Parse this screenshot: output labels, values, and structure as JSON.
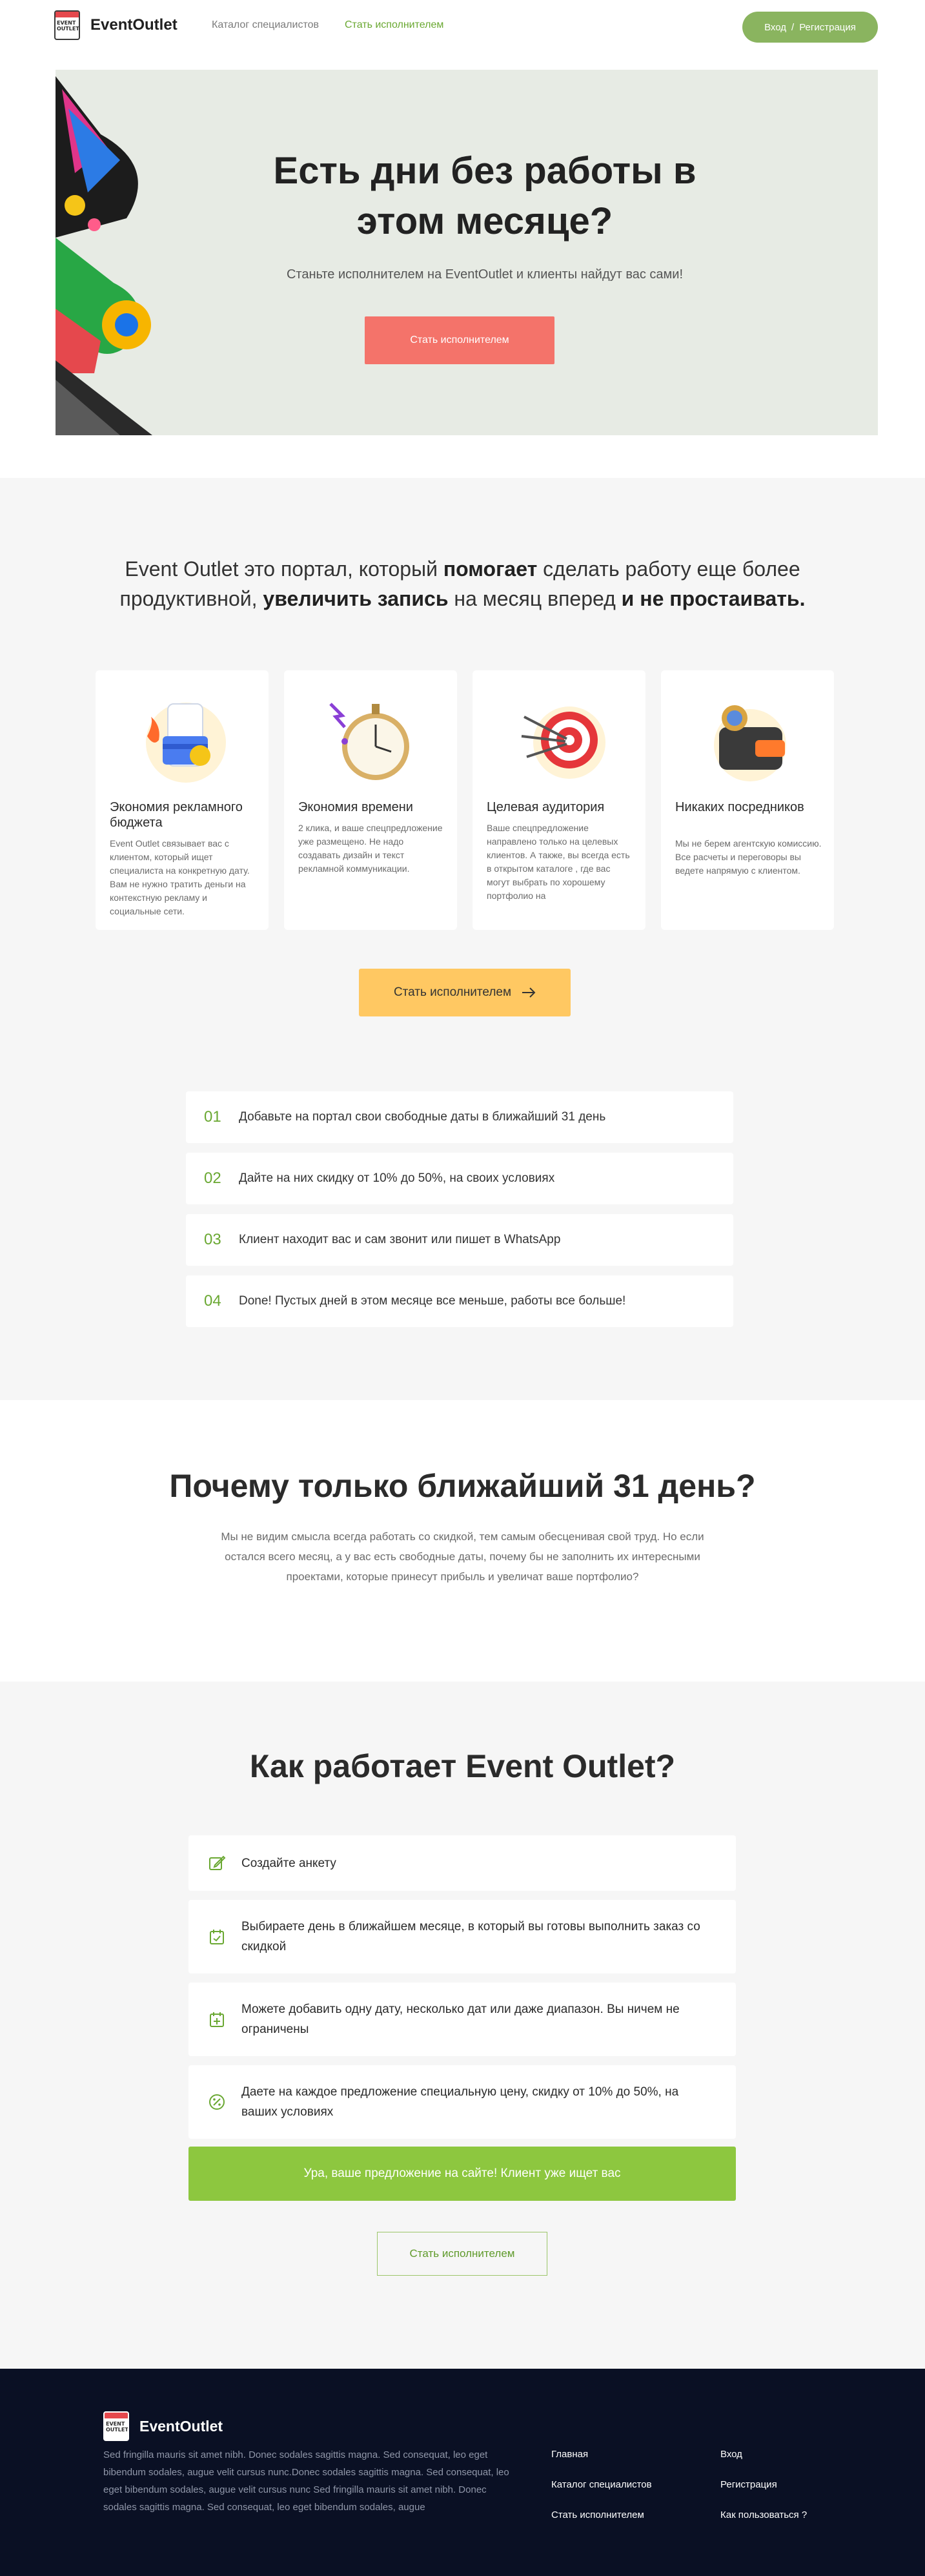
{
  "header": {
    "logo_badge": "EVENT OUTLET",
    "brand": "EventOutlet",
    "nav": [
      "Каталог специалистов",
      "Стать исполнителем"
    ],
    "login": "Вход",
    "separator": "/",
    "register": "Регистрация"
  },
  "hero": {
    "title": "Есть дни без работы в этом месяце?",
    "subtitle": "Станьте исполнителем на EventOutlet и клиенты найдут вас сами!",
    "button": "Стать исполнителем"
  },
  "intro": {
    "p1": "Event Outlet это портал, который ",
    "b1": "помогает",
    "p2": " сделать работу еще более продуктивной, ",
    "b2": "увеличить запись",
    "p3": " на месяц вперед ",
    "b3": "и не простаивать."
  },
  "cards": [
    {
      "title": "Экономия рекламного бюджета",
      "text": "Event Outlet связывает вас с клиентом, который ищет специалиста на конкретную дату. Вам не нужно тратить деньги на контекстную рекламу и социальные сети."
    },
    {
      "title": "Экономия времени",
      "text": "2 клика, и ваше спецпредложение уже размещено. Не надо создавать дизайн и текст рекламной коммуникации."
    },
    {
      "title": "Целевая аудитория",
      "text": "Ваше спецпредложение направлено только на целевых клиентов. А также, вы всегда есть в открытом каталоге , где вас могут выбрать по хорошему портфолио на"
    },
    {
      "title": "Никаких посредников",
      "text": "Мы не берем агентскую комиссию. Все расчеты и переговоры вы ведете напрямую с клиентом."
    }
  ],
  "cta_yellow": "Стать исполнителем",
  "steps": [
    {
      "num": "01",
      "text": "Добавьте на портал свои свободные даты в ближайший 31 день"
    },
    {
      "num": "02",
      "text": "Дайте на них скидку от 10% до 50%, на своих условиях"
    },
    {
      "num": "03",
      "text": "Клиент находит вас и сам звонит или пишет в WhatsApp"
    },
    {
      "num": "04",
      "text": "Done! Пустых дней в этом месяце все меньше, работы все больше!"
    }
  ],
  "why": {
    "title": "Почему только ближайший 31 день?",
    "text": "Мы не видим смысла всегда работать со скидкой, тем самым обесценивая свой труд. Но если остался всего месяц, а у вас есть свободные даты, почему бы не заполнить их интересными проектами, которые принесут прибыль и увеличат ваше портфолио?"
  },
  "how": {
    "title": "Как работает Event Outlet?",
    "items": [
      {
        "icon": "edit-icon",
        "text": "Создайте анкету"
      },
      {
        "icon": "calendar-check-icon",
        "text": "Выбираете день в ближайшем месяце, в который вы готовы выполнить заказ со скидкой"
      },
      {
        "icon": "calendar-plus-icon",
        "text": "Можете добавить одну дату, несколько дат или даже диапазон. Вы ничем не ограничены"
      },
      {
        "icon": "discount-icon",
        "text": "Даете на каждое предложение специальную цену, скидку от 10% до 50%, на ваших условиях"
      }
    ],
    "success": "Ура, ваше предложение на сайте! Клиент уже ищет вас",
    "button": "Стать исполнителем"
  },
  "footer": {
    "brand": "EventOutlet",
    "description": "Sed fringilla mauris sit amet nibh. Donec sodales sagittis magna. Sed consequat, leo eget bibendum sodales, augue velit cursus nunc.Donec sodales sagittis magna. Sed consequat, leo eget bibendum sodales, augue velit cursus nunc Sed fringilla mauris sit amet nibh. Donec sodales sagittis magna. Sed consequat, leo eget bibendum sodales, augue",
    "col1": [
      "Главная",
      "Каталог специалистов",
      "Стать исполнителем"
    ],
    "col2": [
      "Вход",
      "Регистрация",
      "Как пользоваться ?"
    ]
  },
  "colors": {
    "accent_green": "#8ab45f",
    "coral": "#f4736a",
    "yellow": "#ffc862",
    "success_green": "#8dc73f",
    "footer_bg": "#0a1024"
  }
}
